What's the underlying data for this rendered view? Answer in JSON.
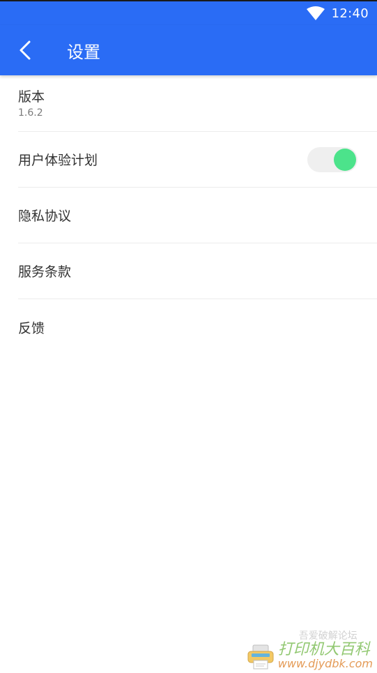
{
  "status_bar": {
    "time": "12:40",
    "wifi_icon": "wifi-icon"
  },
  "app_bar": {
    "title": "设置",
    "back_icon": "chevron-left-icon"
  },
  "settings": {
    "version": {
      "label": "版本",
      "value": "1.6.2"
    },
    "user_experience": {
      "label": "用户体验计划",
      "toggle_on": true
    },
    "privacy": {
      "label": "隐私协议"
    },
    "terms": {
      "label": "服务条款"
    },
    "feedback": {
      "label": "反馈"
    }
  },
  "watermark": {
    "faint_text": "吾爱破解论坛",
    "brand": "打印机大百科",
    "url": "www.djydbk.com"
  },
  "colors": {
    "accent": "#2a6cf5",
    "toggle_knob": "#4ce38b",
    "toggle_track": "#efefef"
  }
}
